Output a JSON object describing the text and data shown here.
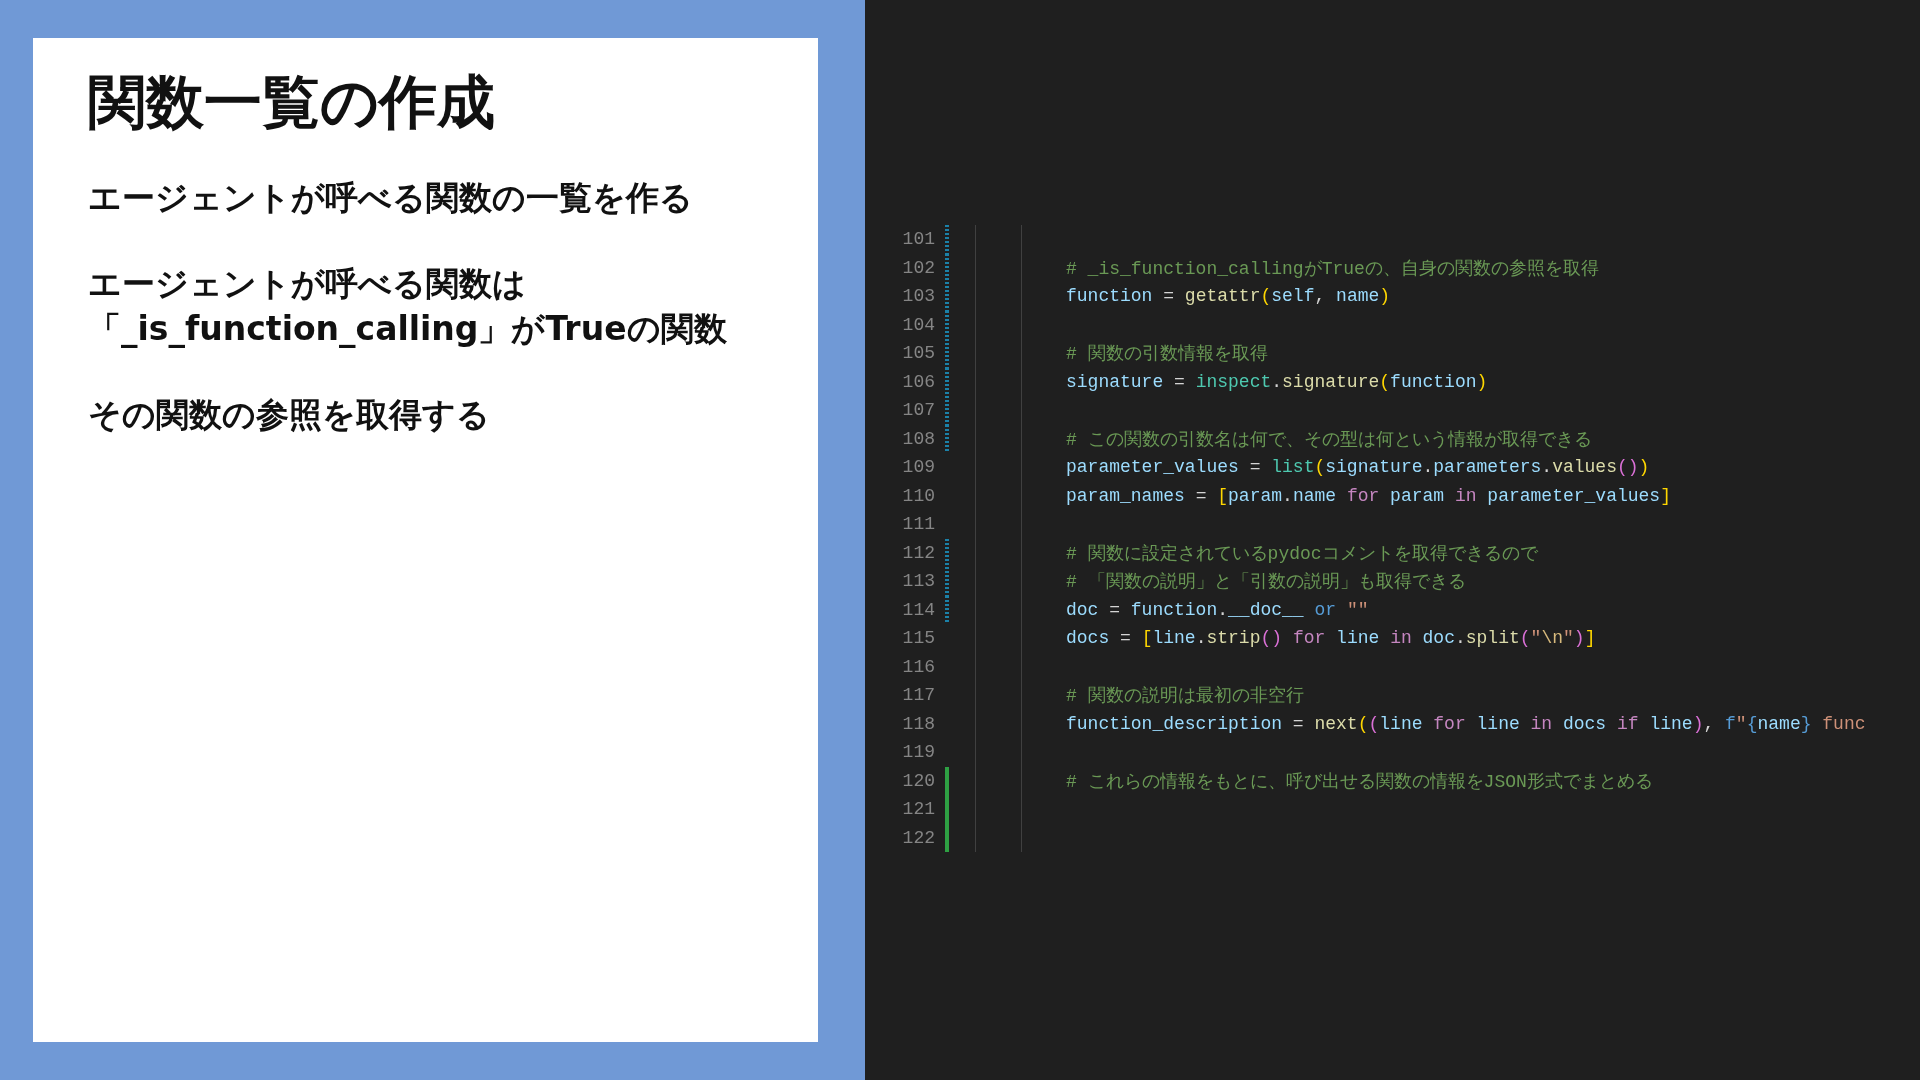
{
  "slide": {
    "title": "関数一覧の作成",
    "bullets": [
      {
        "lines": [
          "エージェントが呼べる関数の一覧を作る"
        ]
      },
      {
        "lines": [
          "エージェントが呼べる関数は",
          "「_is_function_calling」がTrueの関数"
        ]
      },
      {
        "lines": [
          "その関数の参照を取得する"
        ]
      }
    ]
  },
  "editor": {
    "lines": [
      {
        "number": "101",
        "kind": "modified"
      },
      {
        "number": "102",
        "kind": "modified",
        "tokens": [
          {
            "kind": "comment",
            "text": "# _is_function_callingがTrueの、自身の関数の参照を取得"
          }
        ]
      },
      {
        "number": "103",
        "kind": "modified",
        "tokens": [
          {
            "kind": "var",
            "text": "function"
          },
          {
            "kind": "op",
            "text": " = "
          },
          {
            "kind": "func",
            "text": "getattr"
          },
          {
            "kind": "bracket",
            "text": "("
          },
          {
            "kind": "var",
            "text": "self"
          },
          {
            "kind": "op",
            "text": ", "
          },
          {
            "kind": "var",
            "text": "name"
          },
          {
            "kind": "bracket",
            "text": ")"
          }
        ]
      },
      {
        "number": "104",
        "kind": "modified"
      },
      {
        "number": "105",
        "kind": "modified",
        "tokens": [
          {
            "kind": "comment",
            "text": "# 関数の引数情報を取得"
          }
        ]
      },
      {
        "number": "106",
        "kind": "modified",
        "tokens": [
          {
            "kind": "var",
            "text": "signature"
          },
          {
            "kind": "op",
            "text": " = "
          },
          {
            "kind": "class",
            "text": "inspect"
          },
          {
            "kind": "op",
            "text": "."
          },
          {
            "kind": "func",
            "text": "signature"
          },
          {
            "kind": "bracket",
            "text": "("
          },
          {
            "kind": "var",
            "text": "function"
          },
          {
            "kind": "bracket",
            "text": ")"
          }
        ]
      },
      {
        "number": "107",
        "kind": "modified"
      },
      {
        "number": "108",
        "kind": "modified",
        "tokens": [
          {
            "kind": "comment",
            "text": "# この関数の引数名は何で、その型は何という情報が取得できる"
          }
        ]
      },
      {
        "number": "109",
        "kind": "plain",
        "tokens": [
          {
            "kind": "var",
            "text": "parameter_values"
          },
          {
            "kind": "op",
            "text": " = "
          },
          {
            "kind": "class",
            "text": "list"
          },
          {
            "kind": "bracket",
            "text": "("
          },
          {
            "kind": "var",
            "text": "signature"
          },
          {
            "kind": "op",
            "text": "."
          },
          {
            "kind": "var",
            "text": "parameters"
          },
          {
            "kind": "op",
            "text": "."
          },
          {
            "kind": "func",
            "text": "values"
          },
          {
            "kind": "bracket2",
            "text": "()"
          },
          {
            "kind": "bracket",
            "text": ")"
          }
        ]
      },
      {
        "number": "110",
        "kind": "plain",
        "tokens": [
          {
            "kind": "var",
            "text": "param_names"
          },
          {
            "kind": "op",
            "text": " = "
          },
          {
            "kind": "bracket",
            "text": "["
          },
          {
            "kind": "var",
            "text": "param"
          },
          {
            "kind": "op",
            "text": "."
          },
          {
            "kind": "var",
            "text": "name"
          },
          {
            "kind": "keyword",
            "text": " for "
          },
          {
            "kind": "var",
            "text": "param"
          },
          {
            "kind": "keyword",
            "text": " in "
          },
          {
            "kind": "var",
            "text": "parameter_values"
          },
          {
            "kind": "bracket",
            "text": "]"
          }
        ]
      },
      {
        "number": "111",
        "kind": "plain"
      },
      {
        "number": "112",
        "kind": "modified",
        "tokens": [
          {
            "kind": "comment",
            "text": "# 関数に設定されているpydocコメントを取得できるので"
          }
        ]
      },
      {
        "number": "113",
        "kind": "modified",
        "tokens": [
          {
            "kind": "comment",
            "text": "# 「関数の説明」と「引数の説明」も取得できる"
          }
        ]
      },
      {
        "number": "114",
        "kind": "modified",
        "tokens": [
          {
            "kind": "var",
            "text": "doc"
          },
          {
            "kind": "op",
            "text": " = "
          },
          {
            "kind": "var",
            "text": "function"
          },
          {
            "kind": "op",
            "text": "."
          },
          {
            "kind": "var",
            "text": "__doc__"
          },
          {
            "kind": "storage",
            "text": " or "
          },
          {
            "kind": "string",
            "text": "\"\""
          }
        ]
      },
      {
        "number": "115",
        "kind": "plain",
        "tokens": [
          {
            "kind": "var",
            "text": "docs"
          },
          {
            "kind": "op",
            "text": " = "
          },
          {
            "kind": "bracket",
            "text": "["
          },
          {
            "kind": "var",
            "text": "line"
          },
          {
            "kind": "op",
            "text": "."
          },
          {
            "kind": "func",
            "text": "strip"
          },
          {
            "kind": "bracket2",
            "text": "()"
          },
          {
            "kind": "keyword",
            "text": " for "
          },
          {
            "kind": "var",
            "text": "line"
          },
          {
            "kind": "keyword",
            "text": " in "
          },
          {
            "kind": "var",
            "text": "doc"
          },
          {
            "kind": "op",
            "text": "."
          },
          {
            "kind": "func",
            "text": "split"
          },
          {
            "kind": "bracket2",
            "text": "("
          },
          {
            "kind": "string",
            "text": "\""
          },
          {
            "kind": "escape",
            "text": "\\n"
          },
          {
            "kind": "string",
            "text": "\""
          },
          {
            "kind": "bracket2",
            "text": ")"
          },
          {
            "kind": "bracket",
            "text": "]"
          }
        ]
      },
      {
        "number": "116",
        "kind": "plain"
      },
      {
        "number": "117",
        "kind": "plain",
        "tokens": [
          {
            "kind": "comment",
            "text": "# 関数の説明は最初の非空行"
          }
        ]
      },
      {
        "number": "118",
        "kind": "plain",
        "tokens": [
          {
            "kind": "var",
            "text": "function_description"
          },
          {
            "kind": "op",
            "text": " = "
          },
          {
            "kind": "func",
            "text": "next"
          },
          {
            "kind": "bracket",
            "text": "("
          },
          {
            "kind": "bracket2",
            "text": "("
          },
          {
            "kind": "var",
            "text": "line"
          },
          {
            "kind": "keyword",
            "text": " for "
          },
          {
            "kind": "var",
            "text": "line"
          },
          {
            "kind": "keyword",
            "text": " in "
          },
          {
            "kind": "var",
            "text": "docs"
          },
          {
            "kind": "keyword",
            "text": " if "
          },
          {
            "kind": "var",
            "text": "line"
          },
          {
            "kind": "bracket2",
            "text": ")"
          },
          {
            "kind": "op",
            "text": ", "
          },
          {
            "kind": "storage",
            "text": "f"
          },
          {
            "kind": "string",
            "text": "\""
          },
          {
            "kind": "storage",
            "text": "{"
          },
          {
            "kind": "var",
            "text": "name"
          },
          {
            "kind": "storage",
            "text": "}"
          },
          {
            "kind": "string",
            "text": " func"
          }
        ]
      },
      {
        "number": "119",
        "kind": "plain"
      },
      {
        "number": "120",
        "kind": "added",
        "tokens": [
          {
            "kind": "comment",
            "text": "# これらの情報をもとに、呼び出せる関数の情報をJSON形式でまとめる"
          }
        ]
      },
      {
        "number": "121",
        "kind": "added"
      },
      {
        "number": "122",
        "kind": "added"
      }
    ]
  }
}
